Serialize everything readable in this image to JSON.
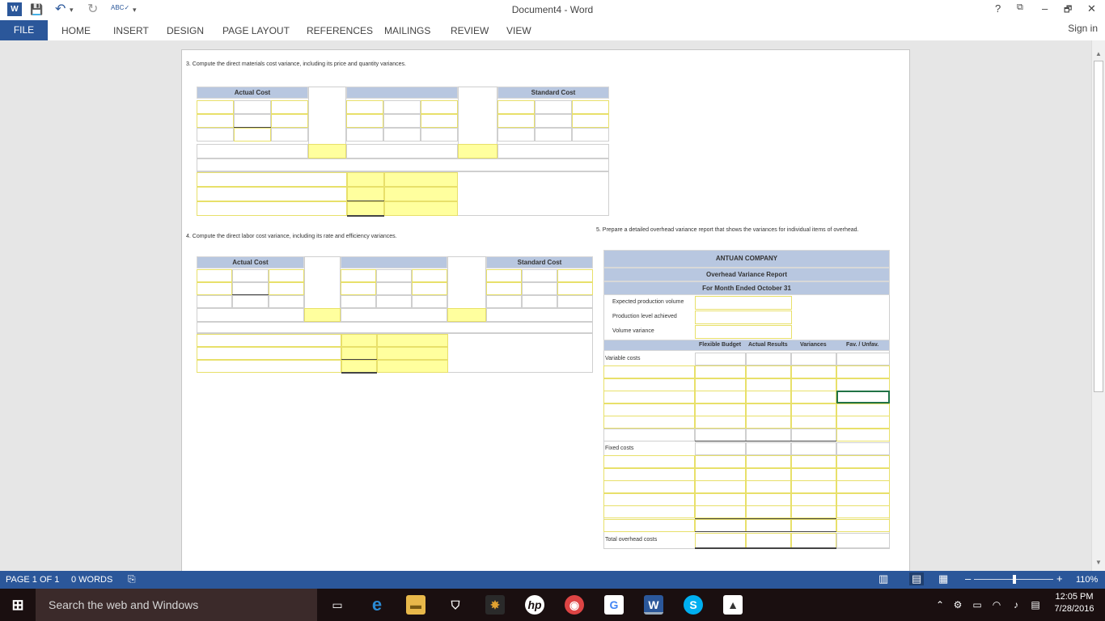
{
  "window": {
    "title": "Document4 - Word",
    "help": "?",
    "restore_ribbon": "⧉",
    "minimize": "–",
    "maximize": "🗗",
    "close": "✕"
  },
  "qat": {
    "word_logo": "W",
    "save": "💾",
    "undo": "↶",
    "undo_dd": "▾",
    "redo": "↻",
    "spelling": "ABC✓",
    "customize": "▾"
  },
  "ribbon": {
    "file": "FILE",
    "tabs": [
      "HOME",
      "INSERT",
      "DESIGN",
      "PAGE LAYOUT",
      "REFERENCES",
      "MAILINGS",
      "REVIEW",
      "VIEW"
    ],
    "sign_in": "Sign in"
  },
  "doc": {
    "q3": "3.  Compute the direct materials cost variance, including its price and quantity variances.",
    "q4": "4.  Compute the direct labor cost variance, including its rate and efficiency variances.",
    "q5": "5.  Prepare a detailed overhead variance report that shows the variances for individual items of overhead.",
    "actual_cost": "Actual Cost",
    "standard_cost": "Standard Cost",
    "report": {
      "company": "ANTUAN COMPANY",
      "title": "Overhead Variance Report",
      "period": "For Month Ended October 31",
      "expected": "Expected production volume",
      "achieved": "Production level achieved",
      "volume_variance": "Volume variance",
      "columns": [
        "Flexible Budget",
        "Actual Results",
        "Variances",
        "Fav. / Unfav."
      ],
      "variable": "Variable costs",
      "fixed": "Fixed costs",
      "total": "Total overhead costs"
    }
  },
  "status": {
    "page": "PAGE 1 OF 1",
    "words": "0 WORDS",
    "zoom": "110%"
  },
  "taskbar": {
    "search_placeholder": "Search the web and Windows",
    "time": "12:05 PM",
    "date": "7/28/2016"
  }
}
